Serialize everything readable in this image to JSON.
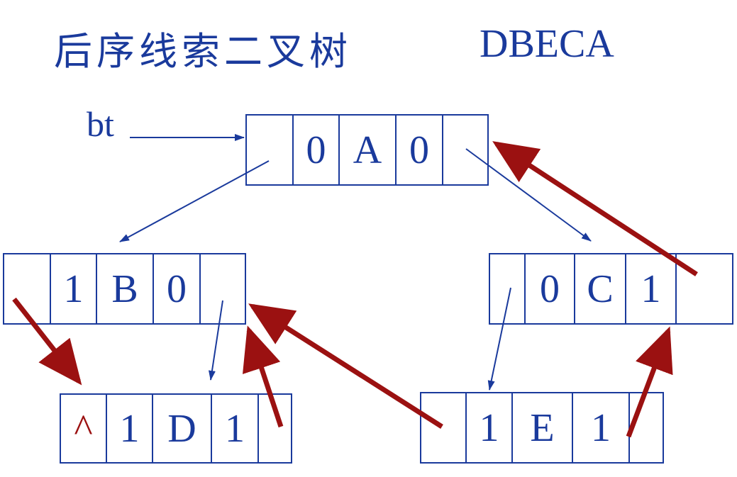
{
  "title": "后序线索二叉树",
  "sequence": "DBECA",
  "root_pointer_label": "bt",
  "colors": {
    "structure": "#1a3a9c",
    "thread": "#9b1111"
  },
  "nodes": {
    "A": {
      "lchild": "",
      "ltag": "0",
      "data": "A",
      "rtag": "0",
      "rchild": ""
    },
    "B": {
      "lchild": "",
      "ltag": "1",
      "data": "B",
      "rtag": "0",
      "rchild": ""
    },
    "C": {
      "lchild": "",
      "ltag": "0",
      "data": "C",
      "rtag": "1",
      "rchild": ""
    },
    "D": {
      "lchild": "^",
      "ltag": "1",
      "data": "D",
      "rtag": "1",
      "rchild": ""
    },
    "E": {
      "lchild": "",
      "ltag": "1",
      "data": "E",
      "rtag": "1",
      "rchild": ""
    }
  },
  "child_links": [
    {
      "from": "A",
      "to": "B",
      "side": "left"
    },
    {
      "from": "A",
      "to": "C",
      "side": "right"
    },
    {
      "from": "B",
      "to": "D",
      "side": "right"
    },
    {
      "from": "C",
      "to": "E",
      "side": "left"
    }
  ],
  "thread_links": [
    {
      "from": "B",
      "to": "D",
      "side": "left"
    },
    {
      "from": "D",
      "to": "B",
      "side": "right"
    },
    {
      "from": "E",
      "to": "B",
      "side": "left"
    },
    {
      "from": "E",
      "to": "C",
      "side": "right"
    },
    {
      "from": "C",
      "to": "A",
      "side": "right"
    }
  ]
}
